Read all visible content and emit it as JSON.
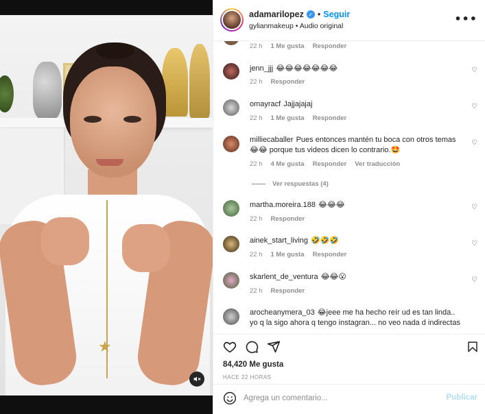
{
  "header": {
    "username": "adamarilopez",
    "verified_glyph": "✓",
    "separator": "•",
    "follow_label": "Seguir",
    "subtitle": "gylianmakeup • Audio original",
    "more_glyph": "•••"
  },
  "comments": [
    {
      "user": "",
      "text": "",
      "time": "22 h",
      "likes": "1 Me gusta",
      "reply": "Responder",
      "extra": ""
    },
    {
      "user": "jenn_jjj",
      "text": "😂😂😂😂😂😂😂",
      "time": "22 h",
      "likes": "",
      "reply": "Responder",
      "extra": ""
    },
    {
      "user": "omayracf",
      "text": "Jajjajajaj",
      "time": "22 h",
      "likes": "1 Me gusta",
      "reply": "Responder",
      "extra": ""
    },
    {
      "user": "milliecaballer",
      "text": "Pues entonces mantén tu boca con otros temas 😂😂 porque tus videos dicen lo contrario.🤩",
      "time": "22 h",
      "likes": "4 Me gusta",
      "reply": "Responder",
      "extra": "Ver traducción"
    },
    {
      "user": "martha.moreira.188",
      "text": "😂😂😂",
      "time": "22 h",
      "likes": "",
      "reply": "Responder",
      "extra": ""
    },
    {
      "user": "ainek_start_living",
      "text": "🤣🤣🤣",
      "time": "22 h",
      "likes": "1 Me gusta",
      "reply": "Responder",
      "extra": ""
    },
    {
      "user": "skarlent_de_ventura",
      "text": "😂😂😮",
      "time": "22 h",
      "likes": "",
      "reply": "Responder",
      "extra": ""
    },
    {
      "user": "arocheanymera_03",
      "text": "😂jeee me ha hecho reír ud es tan linda.. yo q la sigo ahora q tengo instagran... no veo nada d indirectas",
      "time": "",
      "likes": "",
      "reply": "",
      "extra": ""
    }
  ],
  "view_replies": "Ver respuestas (4)",
  "heart_glyph": "♡",
  "likes_total": "84,420 Me gusta",
  "timestamp": "HACE 22 HORAS",
  "add_comment": {
    "placeholder": "Agrega un comentario...",
    "publish_label": "Publicar"
  },
  "colors": {
    "accent": "#0095f6",
    "muted": "#8e8e8e",
    "text": "#262626",
    "publish_disabled": "#b2dffc"
  },
  "icons": [
    "verified-icon",
    "more-options-icon",
    "heart-icon",
    "comment-icon",
    "share-icon",
    "bookmark-icon",
    "emoji-icon",
    "mute-icon"
  ]
}
